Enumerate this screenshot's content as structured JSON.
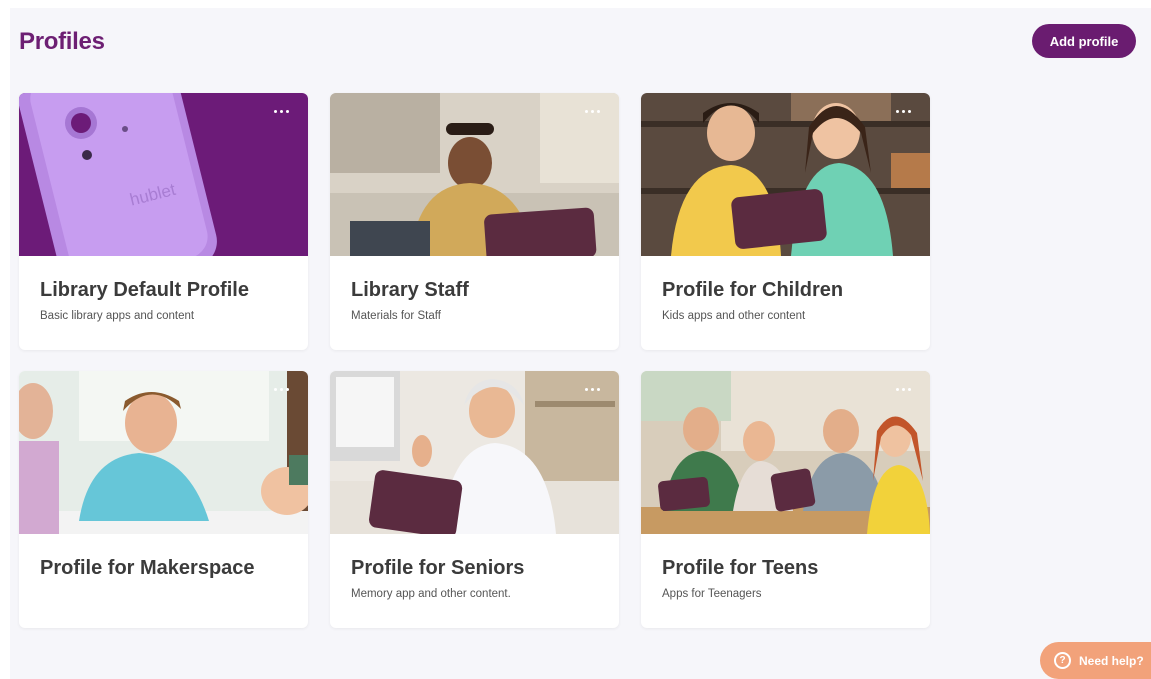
{
  "header": {
    "title": "Profiles",
    "add_button_label": "Add profile"
  },
  "profiles": [
    {
      "title": "Library Default Profile",
      "description": "Basic library apps and content",
      "image": "purple-tablet-product-photo"
    },
    {
      "title": "Library Staff",
      "description": "Materials for Staff",
      "image": "man-using-tablet-on-couch"
    },
    {
      "title": "Profile for Children",
      "description": "Kids apps and other content",
      "image": "two-girls-with-tablet"
    },
    {
      "title": "Profile for Makerspace",
      "description": "",
      "image": "boy-drawing-at-table"
    },
    {
      "title": "Profile for Seniors",
      "description": "Memory app and other content.",
      "image": "senior-woman-with-tablet"
    },
    {
      "title": "Profile for Teens",
      "description": "Apps for Teenagers",
      "image": "teens-at-table-with-tablets"
    }
  ],
  "help": {
    "label": "Need help?",
    "icon": "question-icon"
  },
  "colors": {
    "brand": "#6a1c70",
    "title": "#6d1f73",
    "help": "#f2a27a"
  }
}
